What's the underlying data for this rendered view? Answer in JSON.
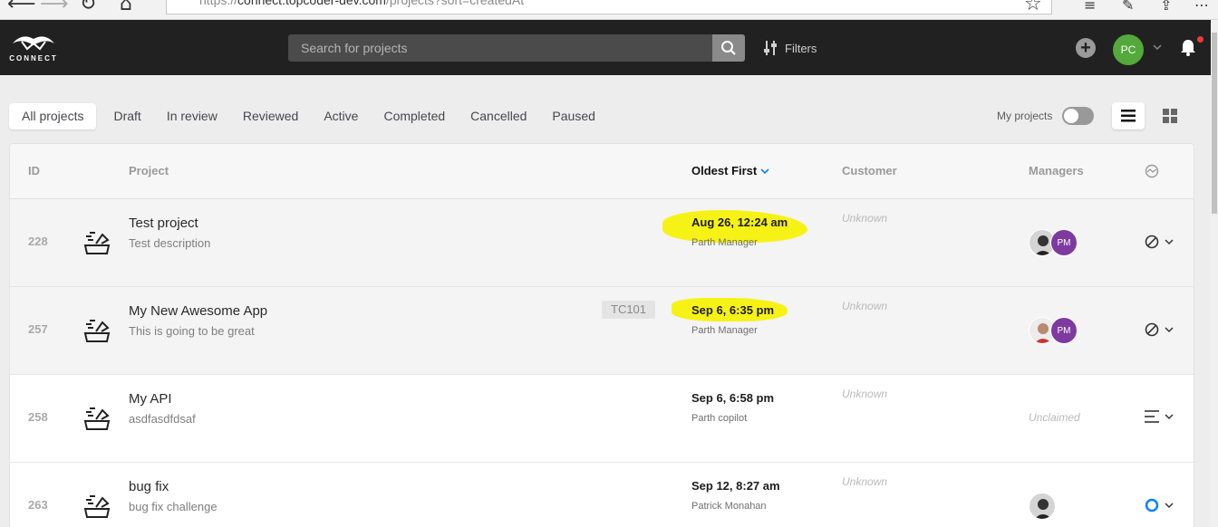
{
  "browser": {
    "url_scheme": "https://",
    "url_host": "connect.topcoder-dev.com",
    "url_path": "/projects?sort=createdAt"
  },
  "topnav": {
    "logo_text": "CONNECT",
    "search_placeholder": "Search for projects",
    "filters_label": "Filters",
    "user_initials": "PC"
  },
  "tabs": [
    {
      "label": "All projects",
      "active": true
    },
    {
      "label": "Draft"
    },
    {
      "label": "In review"
    },
    {
      "label": "Reviewed"
    },
    {
      "label": "Active"
    },
    {
      "label": "Completed"
    },
    {
      "label": "Cancelled"
    },
    {
      "label": "Paused"
    }
  ],
  "my_projects_label": "My projects",
  "table": {
    "headers": {
      "id": "ID",
      "project": "Project",
      "sort": "Oldest First",
      "customer": "Customer",
      "managers": "Managers"
    },
    "rows": [
      {
        "id": "228",
        "name": "Test project",
        "description": "Test description",
        "tag": "",
        "date": "Aug 26, 12:24 am",
        "creator": "Parth Manager",
        "customer": "Unknown",
        "managers": [
          "photo",
          "PM"
        ],
        "status": "cancelled-icon"
      },
      {
        "id": "257",
        "name": "My New Awesome App",
        "description": "This is going to be great",
        "tag": "TC101",
        "date": "Sep 6, 6:35 pm",
        "creator": "Parth Manager",
        "customer": "Unknown",
        "managers": [
          "photo",
          "PM"
        ],
        "status": "cancelled-icon"
      },
      {
        "id": "258",
        "name": "My API",
        "description": "asdfasdfdsaf",
        "tag": "",
        "date": "Sep 6, 6:58 pm",
        "creator": "Parth copilot",
        "customer": "Unknown",
        "managers_text": "Unclaimed",
        "status": "list-icon"
      },
      {
        "id": "263",
        "name": "bug fix",
        "description": "bug fix challenge",
        "tag": "",
        "date": "Sep 12, 8:27 am",
        "creator": "Patrick Monahan",
        "customer": "Unknown",
        "managers": [
          "photo"
        ],
        "status": "in-review-icon"
      }
    ]
  },
  "colors": {
    "nav_bg": "#212121",
    "highlight": "#f7f216",
    "pm_avatar": "#7e3aa0",
    "user_avatar": "#53a93a",
    "accent_blue": "#0a81ff"
  }
}
